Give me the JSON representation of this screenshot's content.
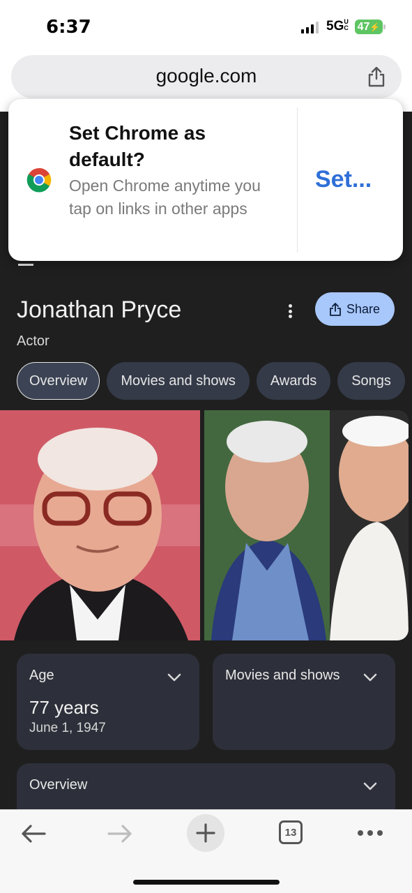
{
  "status": {
    "time": "6:37",
    "network": "5G",
    "network_super": "UC",
    "battery": "47"
  },
  "url_bar": {
    "domain": "google.com",
    "share_icon": "share-icon"
  },
  "popup": {
    "title": "Set Chrome as default?",
    "description": "Open Chrome anytime you tap on links in other apps",
    "action": "Set..."
  },
  "entity": {
    "name": "Jonathan Pryce",
    "subtitle": "Actor",
    "share_label": "Share"
  },
  "tabs": [
    {
      "label": "Overview",
      "active": true
    },
    {
      "label": "Movies and shows",
      "active": false
    },
    {
      "label": "Awards",
      "active": false
    },
    {
      "label": "Songs",
      "active": false
    }
  ],
  "cards": {
    "age": {
      "label": "Age",
      "value": "77 years",
      "date": "June 1, 1947"
    },
    "movies": {
      "label": "Movies and shows"
    },
    "overview": {
      "label": "Overview"
    }
  },
  "toolbar": {
    "tab_count": "13"
  },
  "colors": {
    "page_bg": "#1f1f1f",
    "card_bg": "#2d303a",
    "accent": "#a8c7fa",
    "link_blue": "#2f6fd8"
  }
}
